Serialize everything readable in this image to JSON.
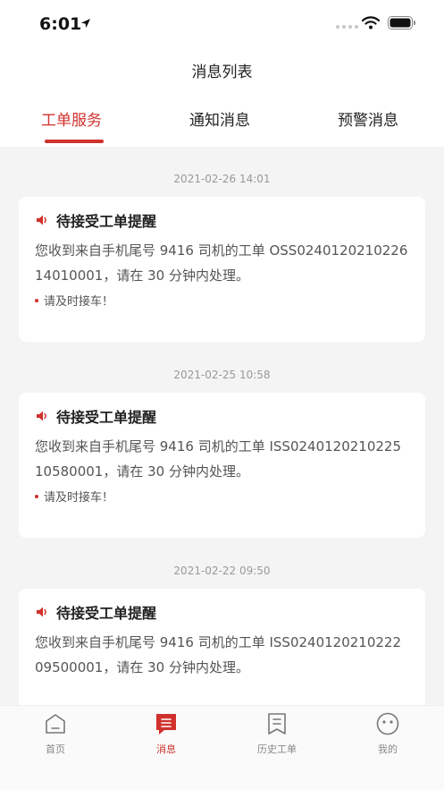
{
  "status_bar": {
    "time": "6:01"
  },
  "nav": {
    "title": "消息列表"
  },
  "tabs": [
    {
      "label": "工单服务"
    },
    {
      "label": "通知消息"
    },
    {
      "label": "预警消息"
    }
  ],
  "messages": [
    {
      "time": "2021-02-26 14:01",
      "title": "待接受工单提醒",
      "body": "您收到来自手机尾号 9416 司机的工单 OSS024012021022614010001，请在 30 分钟内处理。",
      "note": "请及时接车！"
    },
    {
      "time": "2021-02-25 10:58",
      "title": "待接受工单提醒",
      "body": "您收到来自手机尾号 9416 司机的工单 ISS024012021022510580001，请在 30 分钟内处理。",
      "note": "请及时接车！"
    },
    {
      "time": "2021-02-22 09:50",
      "title": "待接受工单提醒",
      "body": "您收到来自手机尾号 9416 司机的工单 ISS024012021022209500001，请在 30 分钟内处理。",
      "note": ""
    }
  ],
  "tabbar": [
    {
      "label": "首页",
      "icon": "home-icon"
    },
    {
      "label": "消息",
      "icon": "message-icon"
    },
    {
      "label": "历史工单",
      "icon": "history-order-icon"
    },
    {
      "label": "我的",
      "icon": "profile-icon"
    }
  ],
  "colors": {
    "accent": "#d0312d",
    "background": "#f4f4f4"
  }
}
